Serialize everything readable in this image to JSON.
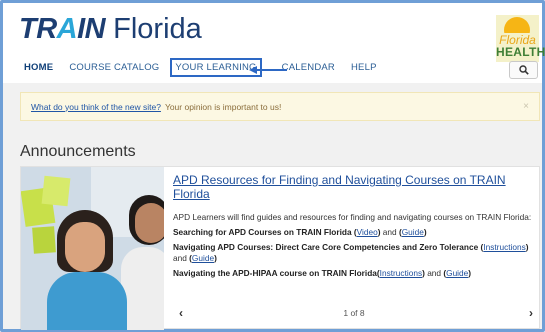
{
  "logo": {
    "train_pre": "TR",
    "train_a": "A",
    "train_post": "IN",
    "florida": "Florida"
  },
  "partner_logo": {
    "line1": "Florida",
    "line2": "HEALTH"
  },
  "nav": {
    "items": [
      "HOME",
      "COURSE CATALOG",
      "YOUR LEARNING",
      "CALENDAR",
      "HELP"
    ],
    "highlighted": "YOUR LEARNING"
  },
  "search": {
    "icon": "search-icon"
  },
  "alert": {
    "link_text": "What do you think of the new site?",
    "message": "Your opinion is important to us!",
    "close": "×"
  },
  "announcements": {
    "heading": "Announcements",
    "card": {
      "title": "APD Resources for Finding and Navigating Courses on TRAIN Florida",
      "intro": "APD Learners will find guides and resources for finding and navigating courses on TRAIN Florida:",
      "item1": {
        "label": "Searching for APD Courses on TRAIN Florida",
        "link1": "Video",
        "and": "and",
        "link2": "Guide"
      },
      "item2": {
        "label": "Navigating APD Courses: Direct Care Core Competencies and Zero Tolerance",
        "link1": "Instructions",
        "and": "and",
        "link2": "Guide"
      },
      "item3": {
        "label": "Navigating the APD-HIPAA course on TRAIN Florida",
        "link1": "Instructions",
        "and": "and",
        "link2": "Guide"
      }
    },
    "pager": {
      "prev": "‹",
      "position": "1 of 8",
      "next": "›"
    }
  },
  "colors": {
    "brand_navy": "#1d3e72",
    "accent_blue": "#2aa6d8",
    "link_blue": "#1f4f9b",
    "highlight_border": "#2d68c4"
  }
}
